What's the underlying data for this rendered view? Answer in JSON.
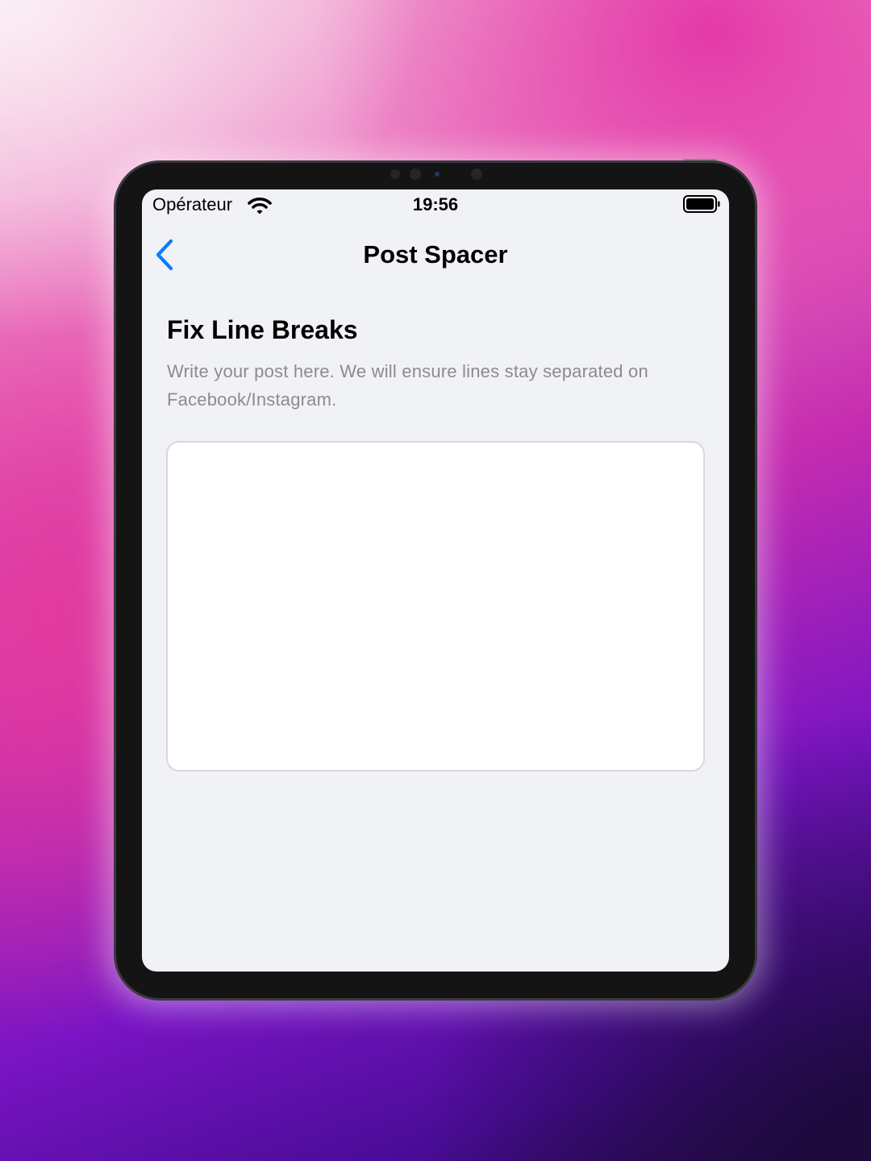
{
  "status_bar": {
    "carrier": "Opérateur",
    "time": "19:56",
    "wifi_icon": "wifi-icon",
    "battery_icon": "battery-full-icon"
  },
  "nav": {
    "back_icon": "chevron-left-icon",
    "title": "Post Spacer"
  },
  "section": {
    "title": "Fix Line Breaks",
    "description": "Write your post here. We will ensure lines stay separated on Facebook/Instagram."
  },
  "editor": {
    "value": "",
    "placeholder": ""
  },
  "colors": {
    "accent": "#0a7cff",
    "screen_background": "#f1f2f6",
    "secondary_text": "#8b8b90",
    "editor_border": "#d8d8dc"
  }
}
